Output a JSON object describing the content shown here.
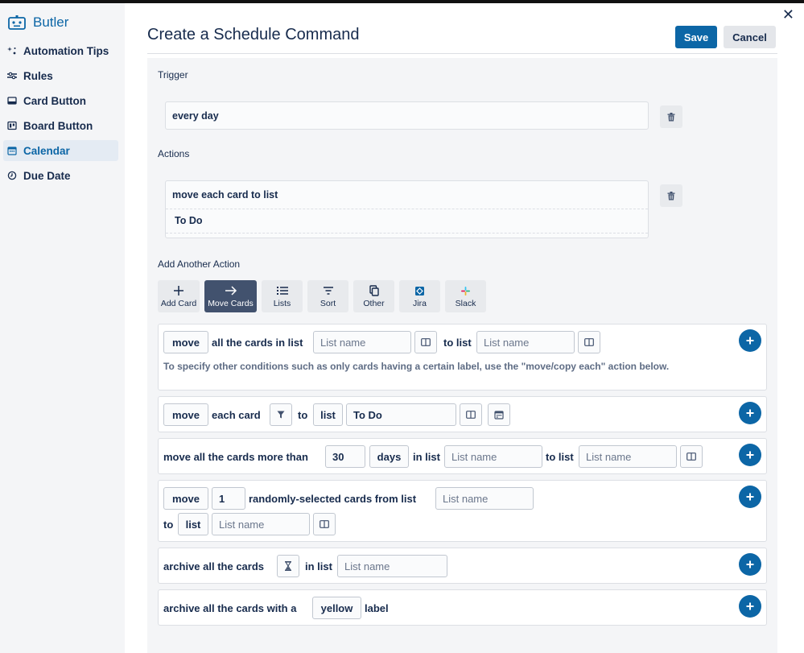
{
  "sidebar": {
    "brand": "Butler",
    "items": [
      {
        "label": "Automation Tips",
        "icon": "sparkle-icon"
      },
      {
        "label": "Rules",
        "icon": "sliders-icon"
      },
      {
        "label": "Card Button",
        "icon": "card-icon"
      },
      {
        "label": "Board Button",
        "icon": "board-icon"
      },
      {
        "label": "Calendar",
        "icon": "calendar-icon",
        "active": true
      },
      {
        "label": "Due Date",
        "icon": "clock-icon"
      }
    ]
  },
  "header": {
    "title": "Create a Schedule Command",
    "save_label": "Save",
    "cancel_label": "Cancel"
  },
  "trigger": {
    "heading": "Trigger",
    "value": "every day"
  },
  "actions": {
    "heading": "Actions",
    "line1": "move each card to list",
    "line2": "To Do"
  },
  "add_action": {
    "heading": "Add Another Action",
    "types": [
      {
        "label": "Add Card",
        "icon": "plus-icon"
      },
      {
        "label": "Move Cards",
        "icon": "arrow-right-icon",
        "active": true
      },
      {
        "label": "Lists",
        "icon": "list-icon"
      },
      {
        "label": "Sort",
        "icon": "sort-icon"
      },
      {
        "label": "Other",
        "icon": "copy-icon"
      },
      {
        "label": "Jira",
        "icon": "jira-icon"
      },
      {
        "label": "Slack",
        "icon": "slack-icon"
      }
    ]
  },
  "cards": {
    "c1": {
      "move": "move",
      "t1": "all the cards in list",
      "list_placeholder": "List name",
      "t2": "to list",
      "note": "To specify other conditions such as only cards having a certain label, use the \"move/copy each\" action below."
    },
    "c2": {
      "move": "move",
      "t1": "each card",
      "t2": "to",
      "list": "list",
      "value": "To Do"
    },
    "c3": {
      "t1": "move all the cards more than",
      "num": "30",
      "unit": "days",
      "t2": "in list",
      "list_placeholder": "List name",
      "t3": "to list"
    },
    "c4": {
      "move": "move",
      "num": "1",
      "t1": "randomly-selected cards from list",
      "list_placeholder": "List name",
      "t2": "to",
      "list": "list"
    },
    "c5": {
      "t1": "archive all the cards",
      "t2": "in list",
      "list_placeholder": "List name"
    },
    "c6": {
      "t1": "archive all the cards with a",
      "color": "yellow",
      "t2": "label"
    }
  },
  "colors": {
    "brand": "#0c66a6",
    "sidebar_bg": "#f4f5f7",
    "active_type": "#42526e"
  }
}
